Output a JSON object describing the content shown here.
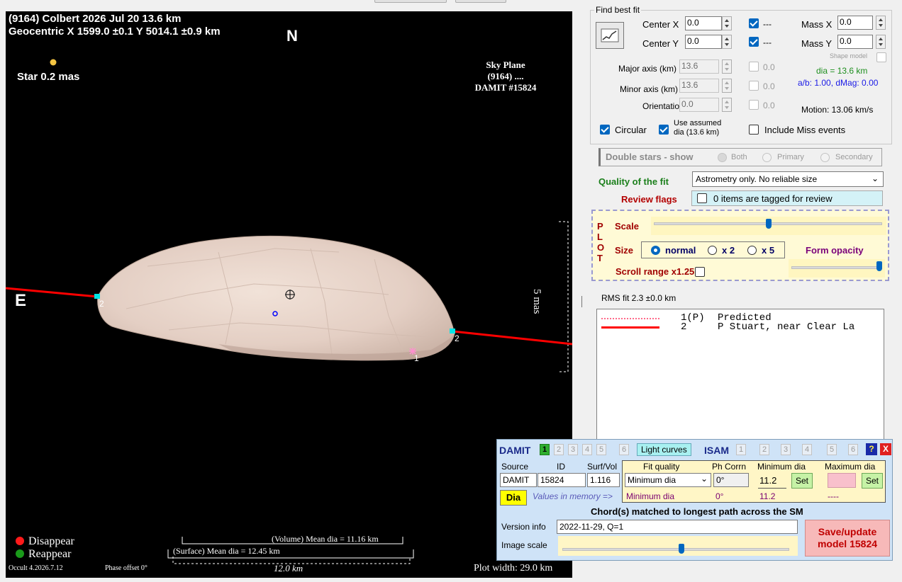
{
  "plot": {
    "title_line1": "(9164) Colbert  2026 Jul 20  13.6 km",
    "title_line2": "Geocentric X  1599.0 ±0.1  Y 5014.1 ±0.9 km",
    "north": "N",
    "east": "E",
    "star_label": "Star 0.2 mas",
    "sky_plane": [
      "Sky Plane",
      "(9164) ....",
      "DAMIT #15824"
    ],
    "scale_label": "5 mas",
    "chord_labels": {
      "left": "2",
      "right": "2",
      "pink": "1"
    },
    "legend_disappear": "Disappear",
    "legend_reappear": "Reappear",
    "volume_mean": "(Volume) Mean dia = 11.16 km",
    "surface_mean": "(Surface) Mean dia = 12.45 km",
    "version": "Occult 4.2026.7.12",
    "phase_offset": "Phase offset 0°",
    "scale_km": "12.0 km",
    "plot_width": "Plot width: 29.0 km",
    "colors": {
      "disappear": "#ff1a1a",
      "reappear": "#1a9a1a",
      "chord": "#ff0000",
      "star": "#f5c542"
    }
  },
  "fit": {
    "group_title": "Find best fit",
    "center_x_label": "Center X",
    "center_x": "0.0",
    "center_y_label": "Center Y",
    "center_y": "0.0",
    "dash1": "---",
    "dash2": "---",
    "mass_x_label": "Mass X",
    "mass_x": "0.0",
    "mass_y_label": "Mass Y",
    "mass_y": "0.0",
    "shape_model": "Shape model",
    "major_label": "Major axis (km)",
    "major": "13.6",
    "major_delta": "0.0",
    "minor_label": "Minor axis (km)",
    "minor": "13.6",
    "minor_delta": "0.0",
    "orient_label": "Orientation",
    "orient": "0.0",
    "orient_delta": "0.0",
    "dia": "dia = 13.6 km",
    "ab": "a/b: 1.00, dMag: 0.00",
    "motion": "Motion: 13.06 km/s",
    "circular": "Circular",
    "assumed": "Use assumed\ndia (13.6 km)",
    "include_miss": "Include Miss events",
    "double_stars": "Double stars - show",
    "both": "Both",
    "primary": "Primary",
    "secondary": "Secondary",
    "quality_label": "Quality of the fit",
    "quality_value": "Astrometry only. No reliable size",
    "review_label": "Review flags",
    "review_value": "0 items are tagged for review"
  },
  "plotbox": {
    "vertical": [
      "P",
      "L",
      "O",
      "T"
    ],
    "scale": "Scale",
    "size": "Size",
    "normal": "normal",
    "x2": "x 2",
    "x5": "x 5",
    "form_opacity": "Form opacity",
    "scroll_range": "Scroll range x1.25"
  },
  "rms": "RMS fit 2.3 ±0.0 km",
  "chords": [
    {
      "num": "1(P)",
      "text": "Predicted",
      "style": "dotted",
      "color": "#ff6b8a"
    },
    {
      "num": "2",
      "text": "P Stuart, near Clear La",
      "style": "solid",
      "color": "#ff0000"
    }
  ],
  "damit": {
    "title": "DAMIT",
    "tabs": [
      "1",
      "2",
      "3",
      "4",
      "5",
      "6"
    ],
    "light_curves": "Light curves",
    "isam": "ISAM",
    "isam_tabs": [
      "1",
      "2",
      "3",
      "4",
      "5",
      "6"
    ],
    "help": "?",
    "close": "X",
    "h_source": "Source",
    "h_id": "ID",
    "h_surf": "Surf/Vol",
    "h_fitq": "Fit quality",
    "h_phcorr": "Ph Corrn",
    "h_min": "Minimum dia",
    "h_max": "Maximum dia",
    "source": "DAMIT",
    "id": "15824",
    "surf": "1.116",
    "fitq": "Minimum dia",
    "phcorr": "0°",
    "min": "11.2",
    "set": "Set",
    "set2": "Set",
    "dia_btn": "Dia",
    "mem_label": "Values in memory =>",
    "mem_fitq": "Minimum dia",
    "mem_ph": "0°",
    "mem_min": "11.2",
    "mem_max": "----",
    "chords_matched": "Chord(s) matched to longest path across the SM",
    "version_label": "Version info",
    "version_value": "2022-11-29, Q=1",
    "image_scale": "Image scale",
    "save": "Save/update\nmodel 15824"
  }
}
